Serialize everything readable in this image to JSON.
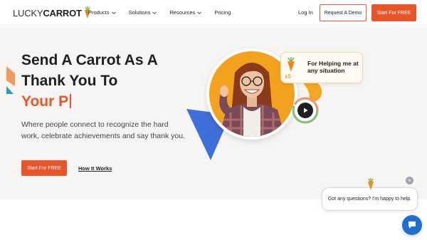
{
  "brand": {
    "name_light": "LUCKY",
    "name_bold": "CARROT",
    "logo_icon": "carrot-icon",
    "accent_color": "#e8552a"
  },
  "nav": {
    "items": [
      {
        "label": "Products",
        "dropdown": true
      },
      {
        "label": "Solutions",
        "dropdown": true
      },
      {
        "label": "Resources",
        "dropdown": true
      },
      {
        "label": "Pricing",
        "dropdown": false
      }
    ],
    "login": "Log In",
    "demo": "Request A Demo",
    "start": "Start For FREE"
  },
  "hero": {
    "headline_line1": "Send A Carrot As A",
    "headline_line2": "Thank You To",
    "headline_typed": "Your P",
    "subtitle": "Where people connect to recognize the hard work, celebrate achievements and say thank you.",
    "cta_primary": "Start For FREE",
    "cta_secondary": "How It Works"
  },
  "illustration": {
    "badge_multiplier": "x5",
    "badge_text": "For Helping me at any situation",
    "play_icon": "play-icon"
  },
  "chat": {
    "message": "Got any questions? I'm happy to help.",
    "close_icon": "close-icon",
    "launcher_icon": "chat-icon"
  }
}
